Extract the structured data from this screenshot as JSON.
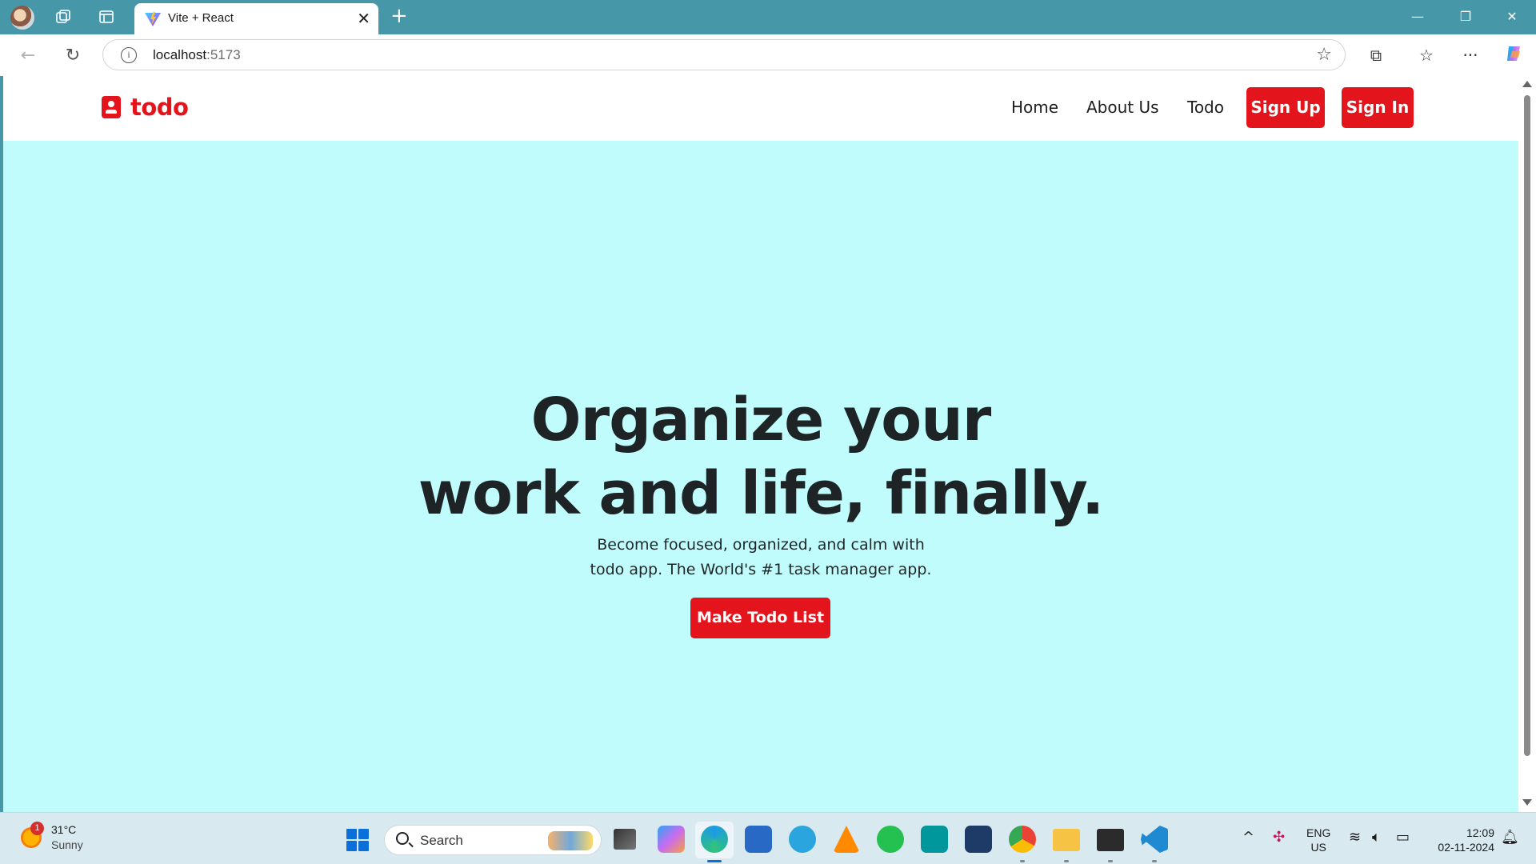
{
  "browser": {
    "tab_title": "Vite + React",
    "tab_close": "✕",
    "new_tab": "+",
    "window_controls": {
      "minimize": "—",
      "restore": "❐",
      "close": "✕"
    },
    "url_host": "localhost",
    "url_port": ":5173"
  },
  "site": {
    "brand": "todo",
    "nav": {
      "home": "Home",
      "about": "About Us",
      "todo": "Todo"
    },
    "signup": "Sign Up",
    "signin": "Sign In",
    "hero_title_line1": "Organize your",
    "hero_title_line2": "work and life, finally.",
    "hero_sub_line1": "Become focused, organized, and calm with",
    "hero_sub_line2": "todo app. The World's #1 task manager app.",
    "cta": "Make Todo List",
    "colors": {
      "accent": "#e3141b",
      "hero_bg": "#c1fcfc"
    }
  },
  "taskbar": {
    "weather_temp": "31°C",
    "weather_cond": "Sunny",
    "weather_badge": "1",
    "search_label": "Search",
    "lang_line1": "ENG",
    "lang_line2": "US",
    "time": "12:09",
    "date": "02-11-2024"
  }
}
